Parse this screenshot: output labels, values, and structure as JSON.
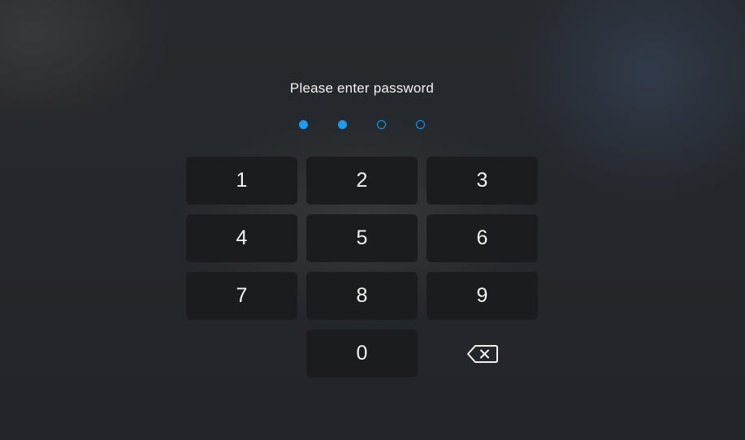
{
  "prompt": {
    "title": "Please enter password"
  },
  "pin": {
    "length": 4,
    "entered": 2,
    "dot_color": "#1d9bf0"
  },
  "keypad": {
    "keys": [
      "1",
      "2",
      "3",
      "4",
      "5",
      "6",
      "7",
      "8",
      "9",
      "0"
    ],
    "backspace_icon": "backspace-icon"
  },
  "colors": {
    "background": "#24272b",
    "key_background": "#1a1c1f",
    "text": "#f4f4f4"
  }
}
